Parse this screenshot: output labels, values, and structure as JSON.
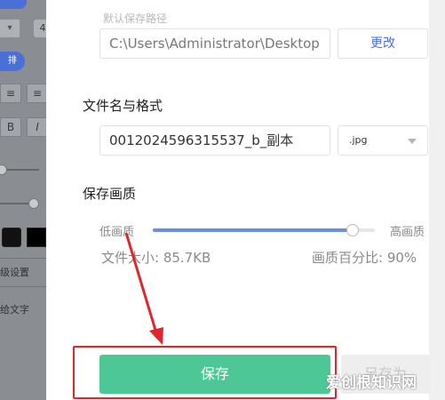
{
  "background_panel": {
    "bold_label": "B",
    "italic_label": "I",
    "advanced_label": "级设置",
    "text_label": "给文字",
    "layout_label": "排"
  },
  "save_path": {
    "label": "默认保存路径",
    "value": "C:\\Users\\Administrator\\Desktop",
    "change_button": "更改"
  },
  "filename": {
    "title": "文件名与格式",
    "value": "0012024596315537_b_副本",
    "format": ".jpg"
  },
  "quality": {
    "title": "保存画质",
    "low_label": "低画质",
    "high_label": "高画质",
    "level": 0.9,
    "file_size_label": "文件大小: 85.7KB",
    "percent_label": "画质百分比: 90%"
  },
  "actions": {
    "save": "保存",
    "save_as": "另存为"
  },
  "watermark": "爱创根知识网",
  "colors": {
    "accent": "#4a6fd9",
    "save_green": "#4cc795",
    "annotation_red": "#e0262b"
  }
}
